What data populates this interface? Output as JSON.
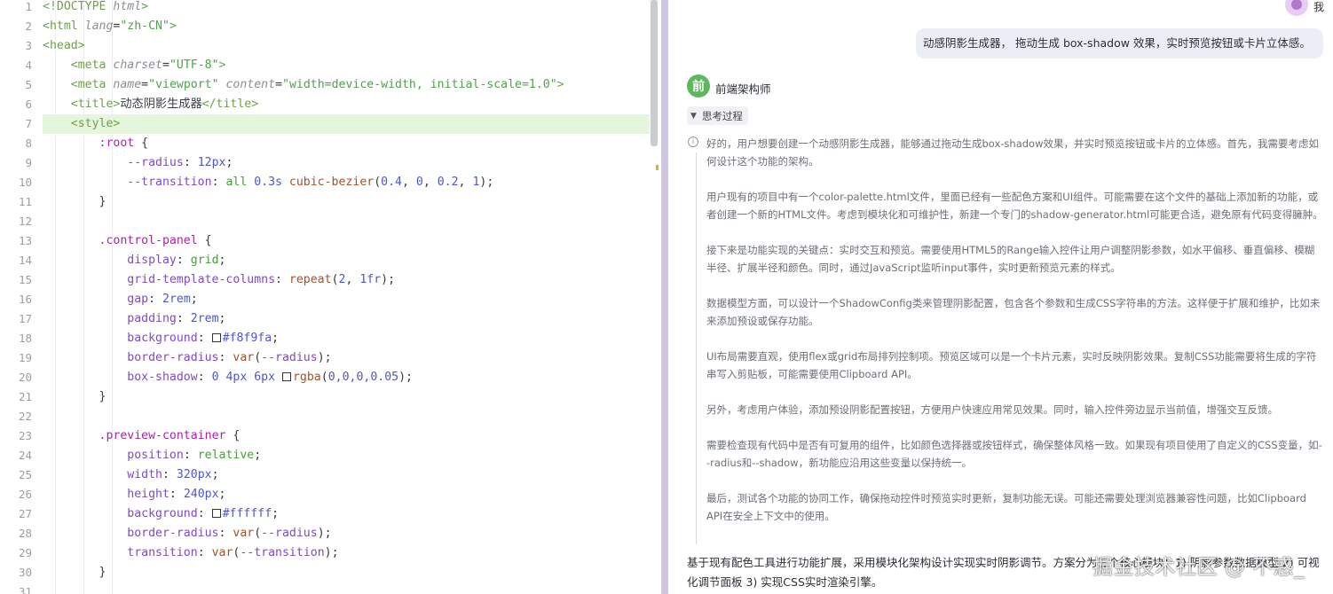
{
  "editor": {
    "active_line": 7,
    "lines": [
      [
        [
          "t-tag",
          "<!DOCTYPE "
        ],
        [
          "t-attr",
          "html"
        ],
        [
          "t-tag",
          ">"
        ]
      ],
      [
        [
          "t-tag",
          "<html "
        ],
        [
          "t-attr",
          "lang"
        ],
        [
          "t-punc",
          "="
        ],
        [
          "t-str",
          "\"zh-CN\""
        ],
        [
          "t-tag",
          ">"
        ]
      ],
      [
        [
          "t-tag",
          "<head>"
        ]
      ],
      [
        [
          "t-txt",
          "    "
        ],
        [
          "t-tag",
          "<meta "
        ],
        [
          "t-attr",
          "charset"
        ],
        [
          "t-punc",
          "="
        ],
        [
          "t-str",
          "\"UTF-8\""
        ],
        [
          "t-tag",
          ">"
        ]
      ],
      [
        [
          "t-txt",
          "    "
        ],
        [
          "t-tag",
          "<meta "
        ],
        [
          "t-attr",
          "name"
        ],
        [
          "t-punc",
          "="
        ],
        [
          "t-str",
          "\"viewport\""
        ],
        [
          "t-txt",
          " "
        ],
        [
          "t-attr",
          "content"
        ],
        [
          "t-punc",
          "="
        ],
        [
          "t-str",
          "\"width=device-width, initial-scale=1.0\""
        ],
        [
          "t-tag",
          ">"
        ]
      ],
      [
        [
          "t-txt",
          "    "
        ],
        [
          "t-tag",
          "<title>"
        ],
        [
          "t-txt",
          "动态阴影生成器"
        ],
        [
          "t-tag",
          "</title>"
        ]
      ],
      [
        [
          "t-txt",
          "    "
        ],
        [
          "t-tag",
          "<style>"
        ]
      ],
      [
        [
          "t-txt",
          "        "
        ],
        [
          "t-sel",
          ":root "
        ],
        [
          "t-punc",
          "{"
        ]
      ],
      [
        [
          "t-txt",
          "            "
        ],
        [
          "t-prop",
          "--radius"
        ],
        [
          "t-punc",
          ": "
        ],
        [
          "t-num",
          "12px"
        ],
        [
          "t-punc",
          ";"
        ]
      ],
      [
        [
          "t-txt",
          "            "
        ],
        [
          "t-prop",
          "--transition"
        ],
        [
          "t-punc",
          ": "
        ],
        [
          "t-val",
          "all "
        ],
        [
          "t-num",
          "0.3s "
        ],
        [
          "t-fn",
          "cubic-bezier"
        ],
        [
          "t-punc",
          "("
        ],
        [
          "t-num",
          "0.4"
        ],
        [
          "t-punc",
          ", "
        ],
        [
          "t-num",
          "0"
        ],
        [
          "t-punc",
          ", "
        ],
        [
          "t-num",
          "0.2"
        ],
        [
          "t-punc",
          ", "
        ],
        [
          "t-num",
          "1"
        ],
        [
          "t-punc",
          ");"
        ]
      ],
      [
        [
          "t-txt",
          "        "
        ],
        [
          "t-punc",
          "}"
        ]
      ],
      [
        [
          "t-txt",
          ""
        ]
      ],
      [
        [
          "t-txt",
          "        "
        ],
        [
          "t-sel",
          ".control-panel "
        ],
        [
          "t-punc",
          "{"
        ]
      ],
      [
        [
          "t-txt",
          "            "
        ],
        [
          "t-prop",
          "display"
        ],
        [
          "t-punc",
          ": "
        ],
        [
          "t-val",
          "grid"
        ],
        [
          "t-punc",
          ";"
        ]
      ],
      [
        [
          "t-txt",
          "            "
        ],
        [
          "t-prop",
          "grid-template-columns"
        ],
        [
          "t-punc",
          ": "
        ],
        [
          "t-fn",
          "repeat"
        ],
        [
          "t-punc",
          "("
        ],
        [
          "t-num",
          "2"
        ],
        [
          "t-punc",
          ", "
        ],
        [
          "t-num",
          "1fr"
        ],
        [
          "t-punc",
          ");"
        ]
      ],
      [
        [
          "t-txt",
          "            "
        ],
        [
          "t-prop",
          "gap"
        ],
        [
          "t-punc",
          ": "
        ],
        [
          "t-num",
          "2rem"
        ],
        [
          "t-punc",
          ";"
        ]
      ],
      [
        [
          "t-txt",
          "            "
        ],
        [
          "t-prop",
          "padding"
        ],
        [
          "t-punc",
          ": "
        ],
        [
          "t-num",
          "2rem"
        ],
        [
          "t-punc",
          ";"
        ]
      ],
      [
        [
          "t-txt",
          "            "
        ],
        [
          "t-prop",
          "background"
        ],
        [
          "t-punc",
          ": "
        ],
        [
          "swatch",
          ""
        ],
        [
          "t-num",
          "#f8f9fa"
        ],
        [
          "t-punc",
          ";"
        ]
      ],
      [
        [
          "t-txt",
          "            "
        ],
        [
          "t-prop",
          "border-radius"
        ],
        [
          "t-punc",
          ": "
        ],
        [
          "t-fn",
          "var"
        ],
        [
          "t-punc",
          "("
        ],
        [
          "t-prop",
          "--radius"
        ],
        [
          "t-punc",
          ");"
        ]
      ],
      [
        [
          "t-txt",
          "            "
        ],
        [
          "t-prop",
          "box-shadow"
        ],
        [
          "t-punc",
          ": "
        ],
        [
          "t-num",
          "0 4px 6px "
        ],
        [
          "swatch",
          ""
        ],
        [
          "t-fn",
          "rgba"
        ],
        [
          "t-punc",
          "("
        ],
        [
          "t-num",
          "0,0,0,0.05"
        ],
        [
          "t-punc",
          ");"
        ]
      ],
      [
        [
          "t-txt",
          "        "
        ],
        [
          "t-punc",
          "}"
        ]
      ],
      [
        [
          "t-txt",
          ""
        ]
      ],
      [
        [
          "t-txt",
          "        "
        ],
        [
          "t-sel",
          ".preview-container "
        ],
        [
          "t-punc",
          "{"
        ]
      ],
      [
        [
          "t-txt",
          "            "
        ],
        [
          "t-prop",
          "position"
        ],
        [
          "t-punc",
          ": "
        ],
        [
          "t-val",
          "relative"
        ],
        [
          "t-punc",
          ";"
        ]
      ],
      [
        [
          "t-txt",
          "            "
        ],
        [
          "t-prop",
          "width"
        ],
        [
          "t-punc",
          ": "
        ],
        [
          "t-num",
          "320px"
        ],
        [
          "t-punc",
          ";"
        ]
      ],
      [
        [
          "t-txt",
          "            "
        ],
        [
          "t-prop",
          "height"
        ],
        [
          "t-punc",
          ": "
        ],
        [
          "t-num",
          "240px"
        ],
        [
          "t-punc",
          ";"
        ]
      ],
      [
        [
          "t-txt",
          "            "
        ],
        [
          "t-prop",
          "background"
        ],
        [
          "t-punc",
          ": "
        ],
        [
          "swatch",
          ""
        ],
        [
          "t-num",
          "#ffffff"
        ],
        [
          "t-punc",
          ";"
        ]
      ],
      [
        [
          "t-txt",
          "            "
        ],
        [
          "t-prop",
          "border-radius"
        ],
        [
          "t-punc",
          ": "
        ],
        [
          "t-fn",
          "var"
        ],
        [
          "t-punc",
          "("
        ],
        [
          "t-prop",
          "--radius"
        ],
        [
          "t-punc",
          ");"
        ]
      ],
      [
        [
          "t-txt",
          "            "
        ],
        [
          "t-prop",
          "transition"
        ],
        [
          "t-punc",
          ": "
        ],
        [
          "t-fn",
          "var"
        ],
        [
          "t-punc",
          "("
        ],
        [
          "t-prop",
          "--transition"
        ],
        [
          "t-punc",
          ");"
        ]
      ],
      [
        [
          "t-txt",
          "        "
        ],
        [
          "t-punc",
          "}"
        ]
      ],
      [
        [
          "t-txt",
          ""
        ]
      ]
    ]
  },
  "chat": {
    "user_name": "我",
    "user_message": "动感阴影生成器， 拖动生成 box-shadow 效果，实时预览按钮或卡片立体感。",
    "bot_avatar_char": "前",
    "bot_name": "前端架构师",
    "thinking_label": "思考过程",
    "thinking_icon": "info-circle-icon",
    "thinking_paragraphs": [
      "好的，用户想要创建一个动感阴影生成器，能够通过拖动生成box-shadow效果，并实时预览按钮或卡片的立体感。首先，我需要考虑如何设计这个功能的架构。",
      "用户现有的项目中有一个color-palette.html文件，里面已经有一些配色方案和UI组件。可能需要在这个文件的基础上添加新的功能，或者创建一个新的HTML文件。考虑到模块化和可维护性，新建一个专门的shadow-generator.html可能更合适，避免原有代码变得臃肿。",
      "接下来是功能实现的关键点：实时交互和预览。需要使用HTML5的Range输入控件让用户调整阴影参数，如水平偏移、垂直偏移、模糊半径、扩展半径和颜色。同时，通过JavaScript监听input事件，实时更新预览元素的样式。",
      "数据模型方面，可以设计一个ShadowConfig类来管理阴影配置，包含各个参数和生成CSS字符串的方法。这样便于扩展和维护，比如未来添加预设或保存功能。",
      "UI布局需要直观，使用flex或grid布局排列控制项。预览区域可以是一个卡片元素，实时反映阴影效果。复制CSS功能需要将生成的字符串写入剪贴板，可能需要使用Clipboard API。",
      "另外，考虑用户体验，添加预设阴影配置按钮，方便用户快速应用常见效果。同时，输入控件旁边显示当前值，增强交互反馈。",
      "需要检查现有代码中是否有可复用的组件，比如颜色选择器或按钮样式，确保整体风格一致。如果现有项目使用了自定义的CSS变量，如--radius和--shadow，新功能应沿用这些变量以保持统一。",
      "最后，测试各个功能的协同工作，确保拖动控件时预览实时更新，复制功能无误。可能还需要处理浏览器兼容性问题，比如Clipboard API在安全上下文中的使用。"
    ],
    "answer": "基于现有配色工具进行功能扩展，采用模块化架构设计实现实时阴影调节。方案分为三个核心模块：1) 阴影参数数据模型 2) 可视化调节面板 3) 实现CSS实时渲染引擎。",
    "watermark": "掘金技术社区 @ 不惑_"
  },
  "colors": {
    "active_line_bg": "#e6f6dd",
    "divider": "#cfc6e3",
    "bot_avatar": "#5cb85c",
    "user_bubble": "#eceef5"
  }
}
